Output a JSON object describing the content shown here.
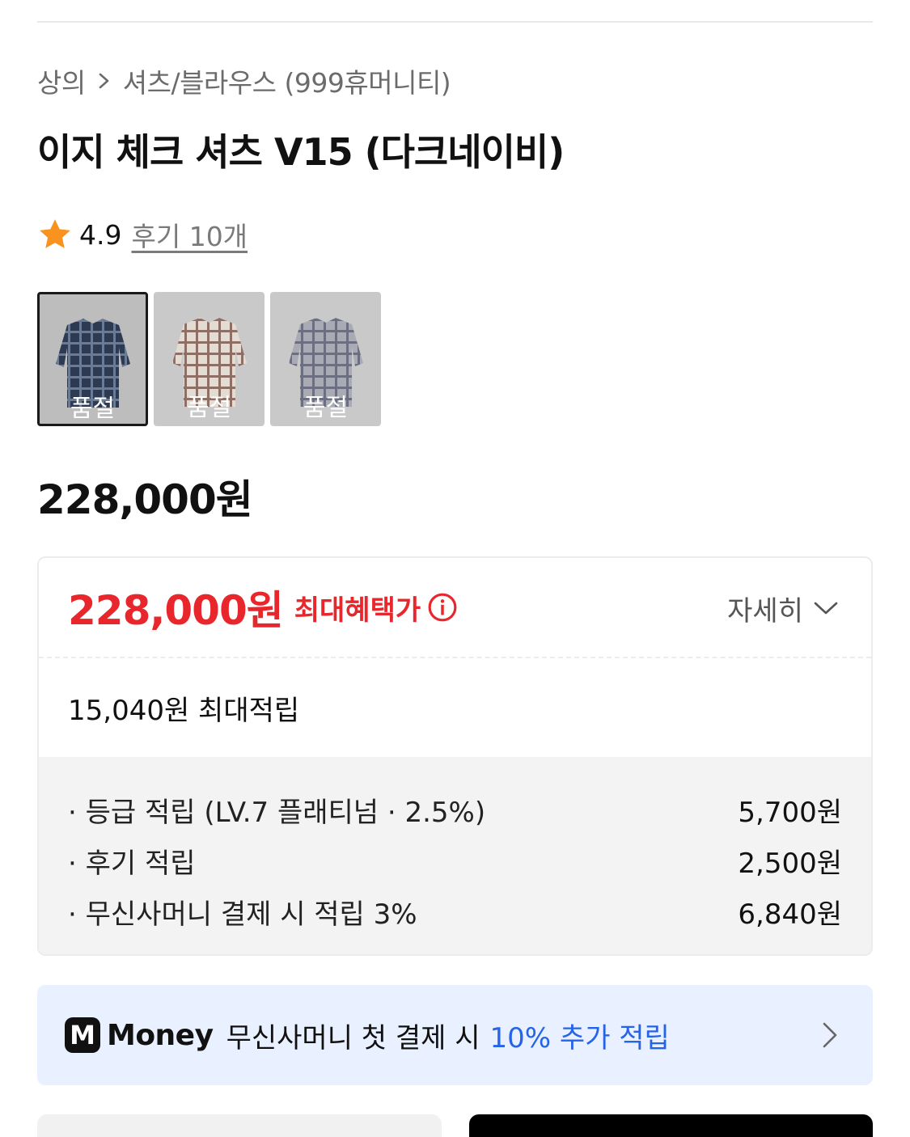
{
  "breadcrumb": {
    "category": "상의",
    "subcategory": "셔츠/블라우스 (999휴머니티)"
  },
  "product": {
    "title": "이지 체크 셔츠 V15 (다크네이비)",
    "rating": "4.9",
    "reviews_label": "후기 10개",
    "price": "228,000원"
  },
  "thumbnails": [
    {
      "label": "품절",
      "color": "dark-navy",
      "selected": true
    },
    {
      "label": "품절",
      "color": "beige",
      "selected": false
    },
    {
      "label": "품절",
      "color": "grey",
      "selected": false
    }
  ],
  "benefit": {
    "price": "228,000원",
    "label": "최대혜택가",
    "detail_label": "자세히",
    "reward_total": "15,040원 최대적립",
    "items": [
      {
        "label": "· 등급 적립 (LV.7 플래티넘 · 2.5%)",
        "amount": "5,700원"
      },
      {
        "label": "· 후기 적립",
        "amount": "2,500원"
      },
      {
        "label": "· 무신사머니 결제 시 적립 3%",
        "amount": "6,840원"
      }
    ]
  },
  "money_banner": {
    "logo": "M",
    "brand": "Money",
    "text": "무신사머니 첫 결제 시",
    "accent": "10% 추가 적립"
  },
  "colors": {
    "accent_red": "#e8272d",
    "accent_blue": "#2563eb",
    "star": "#f7931e"
  }
}
